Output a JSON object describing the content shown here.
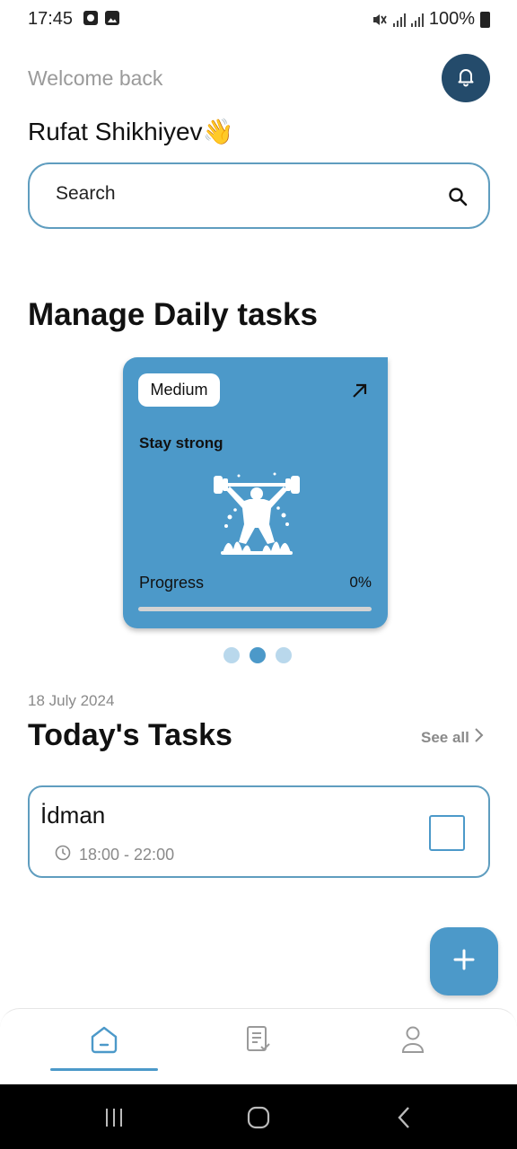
{
  "status_bar": {
    "time": "17:45",
    "battery": "100%"
  },
  "header": {
    "welcome": "Welcome back",
    "user_name": "Rufat Shikhiyev👋"
  },
  "search": {
    "placeholder": "Search"
  },
  "section": {
    "title": "Manage Daily tasks"
  },
  "task_card": {
    "priority": "Medium",
    "title": "Stay strong",
    "progress_label": "Progress",
    "progress_text": "0%",
    "progress_value": 0
  },
  "carousel": {
    "page_count": 3,
    "active_index": 1
  },
  "today": {
    "date": "18 July 2024",
    "title": "Today's Tasks",
    "see_all": "See all",
    "tasks": [
      {
        "name": "İdman",
        "time": "18:00 - 22:00",
        "completed": false
      }
    ]
  },
  "colors": {
    "accent": "#4c99c9",
    "bell_bg": "#244b6b",
    "border": "#5f9dbf"
  },
  "icons": {
    "bell": "bell-icon",
    "search": "search-icon",
    "arrow": "arrow-up-right-icon",
    "clock": "clock-icon",
    "add": "plus-icon",
    "nav_home": "home-icon",
    "nav_tasks": "task-list-icon",
    "nav_profile": "profile-icon"
  }
}
